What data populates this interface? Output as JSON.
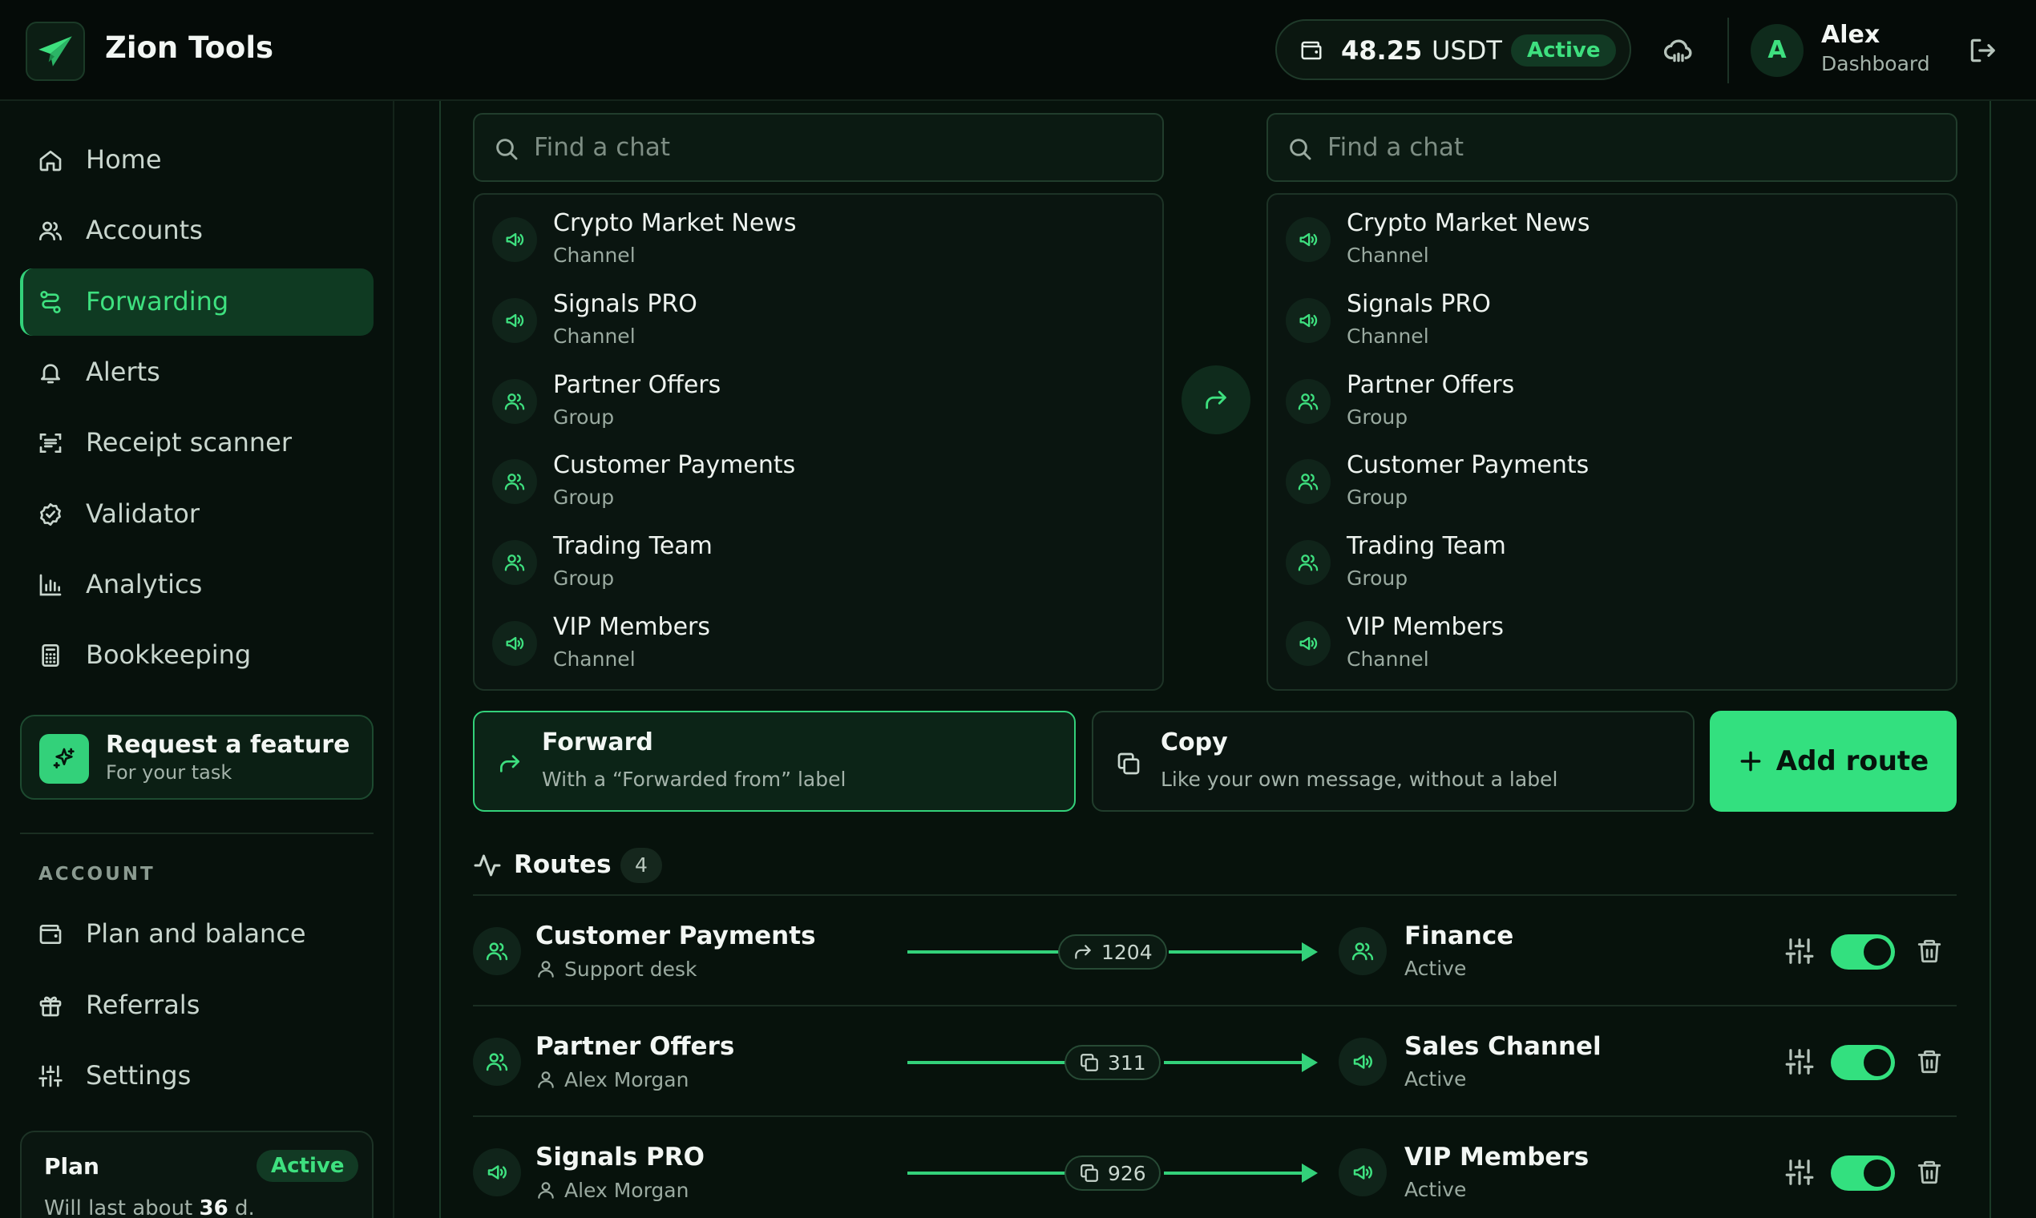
{
  "header": {
    "app_title": "Zion Tools",
    "balance_amount": "48.25",
    "balance_currency": "USDT",
    "balance_status": "Active",
    "user_initial": "A",
    "user_name": "Alex",
    "user_role": "Dashboard"
  },
  "sidebar": {
    "nav": [
      {
        "label": "Home",
        "icon": "home-icon"
      },
      {
        "label": "Accounts",
        "icon": "users-icon"
      },
      {
        "label": "Forwarding",
        "icon": "route-icon",
        "active": true
      },
      {
        "label": "Alerts",
        "icon": "bell-icon"
      },
      {
        "label": "Receipt scanner",
        "icon": "scan-icon"
      },
      {
        "label": "Validator",
        "icon": "badge-check-icon"
      },
      {
        "label": "Analytics",
        "icon": "bar-chart-icon"
      },
      {
        "label": "Bookkeeping",
        "icon": "calculator-icon"
      }
    ],
    "feature_title": "Request a feature",
    "feature_subtitle": "For your task",
    "account_section_label": "ACCOUNT",
    "account_nav": [
      {
        "label": "Plan and balance",
        "icon": "wallet-icon"
      },
      {
        "label": "Referrals",
        "icon": "gift-icon"
      },
      {
        "label": "Settings",
        "icon": "sliders-icon"
      }
    ],
    "plan": {
      "title": "Plan",
      "status": "Active",
      "text_prefix": "Will last about",
      "days": "36",
      "text_suffix": "d."
    }
  },
  "source": {
    "search_placeholder": "Find a chat",
    "chats": [
      {
        "name": "Crypto Market News",
        "type": "Channel",
        "icon": "megaphone-icon"
      },
      {
        "name": "Signals PRO",
        "type": "Channel",
        "icon": "megaphone-icon"
      },
      {
        "name": "Partner Offers",
        "type": "Group",
        "icon": "users-icon"
      },
      {
        "name": "Customer Payments",
        "type": "Group",
        "icon": "users-icon"
      },
      {
        "name": "Trading Team",
        "type": "Group",
        "icon": "users-icon"
      },
      {
        "name": "VIP Members",
        "type": "Channel",
        "icon": "megaphone-icon"
      }
    ]
  },
  "destination": {
    "search_placeholder": "Find a chat",
    "chats": [
      {
        "name": "Crypto Market News",
        "type": "Channel",
        "icon": "megaphone-icon"
      },
      {
        "name": "Signals PRO",
        "type": "Channel",
        "icon": "megaphone-icon"
      },
      {
        "name": "Partner Offers",
        "type": "Group",
        "icon": "users-icon"
      },
      {
        "name": "Customer Payments",
        "type": "Group",
        "icon": "users-icon"
      },
      {
        "name": "Trading Team",
        "type": "Group",
        "icon": "users-icon"
      },
      {
        "name": "VIP Members",
        "type": "Channel",
        "icon": "megaphone-icon"
      }
    ]
  },
  "modes": {
    "forward": {
      "title": "Forward",
      "description": "With a “Forwarded from” label",
      "selected": true
    },
    "copy": {
      "title": "Copy",
      "description": "Like your own message, without a label",
      "selected": false
    }
  },
  "add_route_label": "Add route",
  "routes": {
    "title": "Routes",
    "count": "4",
    "items": [
      {
        "source": "Customer Payments",
        "source_icon": "users-icon",
        "owner": "Support desk",
        "mode_icon": "forward-icon",
        "count": "1204",
        "destination": "Finance",
        "destination_icon": "users-icon",
        "status": "Active",
        "enabled": true
      },
      {
        "source": "Partner Offers",
        "source_icon": "users-icon",
        "owner": "Alex Morgan",
        "mode_icon": "copy-icon",
        "count": "311",
        "destination": "Sales Channel",
        "destination_icon": "megaphone-icon",
        "status": "Active",
        "enabled": true
      },
      {
        "source": "Signals PRO",
        "source_icon": "megaphone-icon",
        "owner": "Alex Morgan",
        "mode_icon": "copy-icon",
        "count": "926",
        "destination": "VIP Members",
        "destination_icon": "megaphone-icon",
        "status": "Active",
        "enabled": true
      }
    ]
  },
  "colors": {
    "accent": "#33e07f",
    "background": "#07110c",
    "active_nav_bg": "#0f3a22"
  }
}
